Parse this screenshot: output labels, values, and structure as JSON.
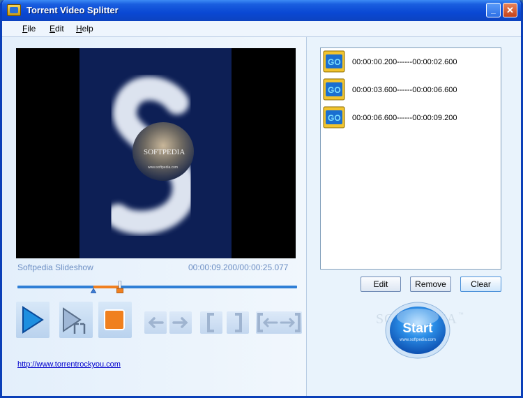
{
  "window": {
    "title": "Torrent Video Splitter",
    "minimize_glyph": "_",
    "close_glyph": "✕"
  },
  "menu": [
    {
      "hotkey": "F",
      "rest": "ile"
    },
    {
      "hotkey": "E",
      "rest": "dit"
    },
    {
      "hotkey": "H",
      "rest": "elp"
    }
  ],
  "player": {
    "clip_name": "Softpedia Slideshow",
    "time_code": "00:00:09.200/00:00:25.077",
    "preview_text": "SOFTPEDIA",
    "preview_url": "www.softpedia.com",
    "progress": 0.367,
    "range_start": 0.272,
    "range_end": 0.367
  },
  "toolbar": {
    "icons": [
      "play-icon",
      "play-segment-icon",
      "stop-icon",
      "arrow-left-icon",
      "arrow-right-icon",
      "bracket-open-icon",
      "bracket-close-icon",
      "bracket-arrows-icon"
    ]
  },
  "link": {
    "url_text": "http://www.torrentrockyou.com"
  },
  "segments": [
    {
      "range": "00:00:00.200------00:00:02.600"
    },
    {
      "range": "00:00:03.600------00:00:06.600"
    },
    {
      "range": "00:00:06.600------00:00:09.200"
    }
  ],
  "buttons": {
    "edit": "Edit",
    "remove": "Remove",
    "clear": "Clear",
    "start": "Start",
    "start_sub": "www.softpedia.com"
  },
  "watermark": {
    "text": "SOFTPEDIA",
    "tm": "™"
  },
  "colors": {
    "accent": "#2f7fd6",
    "range": "#f08020",
    "title_bar": "#0a48d4"
  }
}
